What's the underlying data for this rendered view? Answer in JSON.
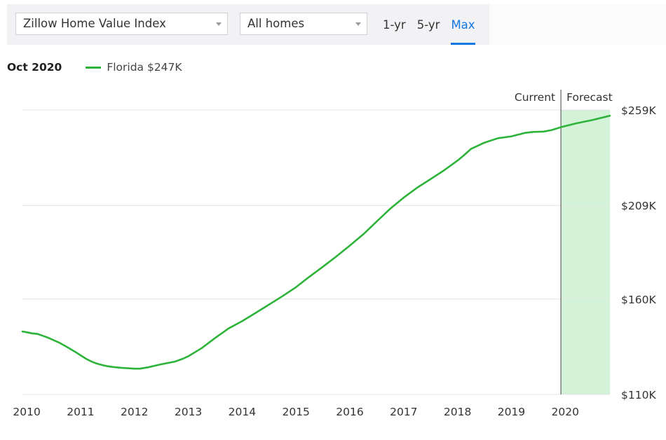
{
  "toolbar": {
    "metric_select": "Zillow Home Value Index",
    "home_type_select": "All homes",
    "ranges": [
      "1-yr",
      "5-yr",
      "Max"
    ],
    "active_range": "Max"
  },
  "legend": {
    "date": "Oct 2020",
    "series_label": "Florida $247K"
  },
  "colors": {
    "line": "#2eb33a",
    "forecast_fill": "#d4f2d7",
    "active_tab": "#1277e1",
    "grid": "#e6e6e6"
  },
  "chart_data": {
    "type": "line",
    "current_label": "Current",
    "forecast_label": "Forecast",
    "forecast_start": 2019.92,
    "x_tick_labels": [
      "2010",
      "2011",
      "2012",
      "2013",
      "2014",
      "2015",
      "2016",
      "2017",
      "2018",
      "2019",
      "2020"
    ],
    "y_tick_labels": [
      "$259K",
      "$209K",
      "$160K",
      "$110K"
    ],
    "xlim": [
      2009.92,
      2020.83
    ],
    "ylim": [
      110,
      259
    ],
    "grid": true,
    "series": [
      {
        "name": "Florida",
        "x": [
          2009.92,
          2010.0,
          2010.1,
          2010.2,
          2010.3,
          2010.4,
          2010.5,
          2010.6,
          2010.75,
          2010.9,
          2011.0,
          2011.1,
          2011.2,
          2011.3,
          2011.4,
          2011.5,
          2011.6,
          2011.75,
          2011.9,
          2012.0,
          2012.1,
          2012.25,
          2012.4,
          2012.5,
          2012.75,
          2012.9,
          2013.0,
          2013.25,
          2013.5,
          2013.75,
          2014.0,
          2014.25,
          2014.5,
          2014.75,
          2015.0,
          2015.25,
          2015.5,
          2015.75,
          2016.0,
          2016.25,
          2016.5,
          2016.75,
          2017.0,
          2017.25,
          2017.5,
          2017.75,
          2018.0,
          2018.1,
          2018.25,
          2018.5,
          2018.75,
          2019.0,
          2019.25,
          2019.4,
          2019.5,
          2019.6,
          2019.75,
          2019.92,
          2020.2,
          2020.5,
          2020.83
        ],
        "y": [
          143,
          142.6,
          142,
          141.7,
          140.7,
          139.7,
          138.4,
          137.2,
          134.8,
          132.3,
          130.5,
          128.7,
          127.3,
          126.2,
          125.4,
          124.8,
          124.4,
          124.0,
          123.7,
          123.5,
          123.5,
          124.2,
          125.2,
          125.8,
          127.2,
          128.7,
          130.0,
          134.3,
          139.6,
          144.6,
          148.4,
          152.7,
          157.1,
          161.5,
          166.2,
          171.7,
          176.9,
          182.3,
          188.0,
          193.9,
          200.6,
          207.3,
          213.1,
          218.3,
          222.8,
          227.4,
          232.5,
          234.8,
          238.6,
          241.9,
          244.2,
          245.2,
          247.0,
          247.5,
          247.6,
          247.7,
          248.5,
          250.0,
          252.0,
          253.7,
          256.0
        ]
      }
    ]
  }
}
